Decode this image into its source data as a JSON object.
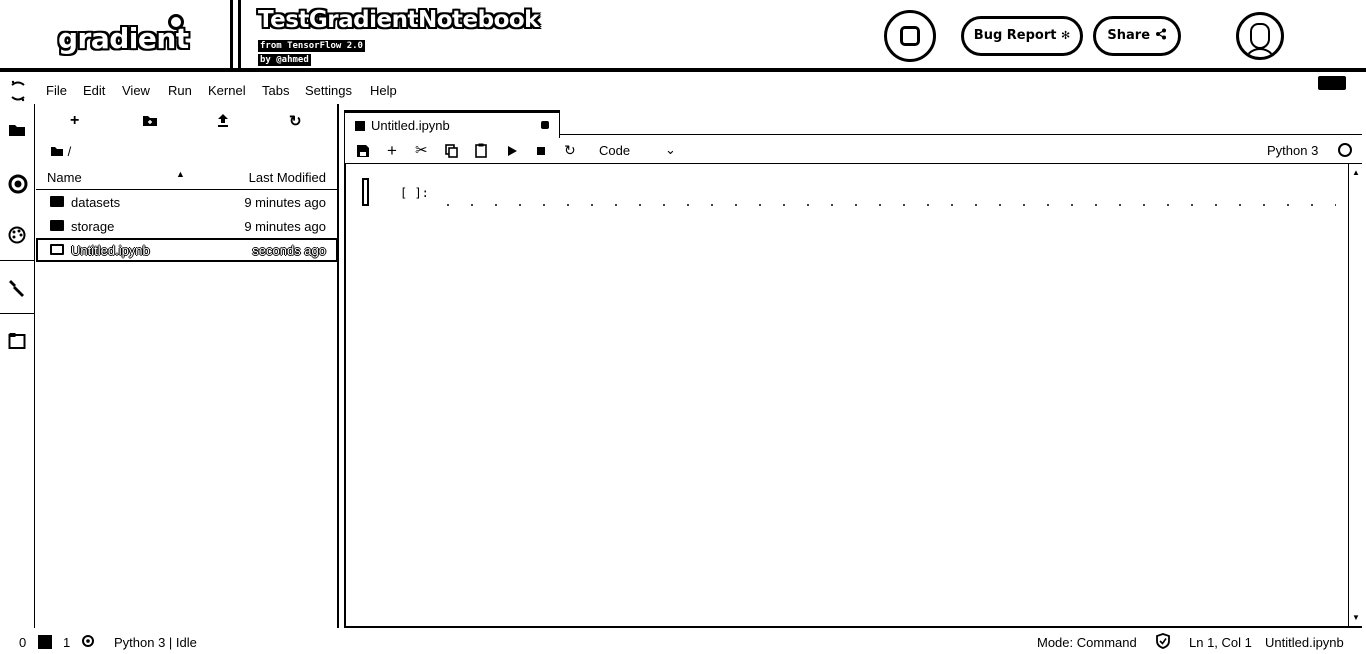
{
  "header": {
    "brand": "gradient",
    "notebook_title": "TestGradientNotebook",
    "subtitle_container": "from TensorFlow 2.0",
    "subtitle_author": "by @ahmed",
    "bug_report_label": "Bug Report",
    "share_label": "Share"
  },
  "menu": {
    "items": [
      "File",
      "Edit",
      "View",
      "Run",
      "Kernel",
      "Tabs",
      "Settings",
      "Help"
    ]
  },
  "file_browser": {
    "breadcrumb": "/",
    "col_name": "Name",
    "col_modified": "Last Modified",
    "files": [
      {
        "name": "datasets",
        "modified": "9 minutes ago",
        "type": "folder-icon"
      },
      {
        "name": "storage",
        "modified": "9 minutes ago",
        "type": "folder-icon"
      },
      {
        "name": "Untitled.ipynb",
        "modified": "seconds ago",
        "type": "notebook-icon"
      }
    ]
  },
  "notebook": {
    "tab_label": "Untitled.ipynb",
    "cell_type": "Code",
    "kernel": "Python 3",
    "cell_prompt": "[ ]:"
  },
  "status": {
    "zero": "0",
    "one": "1",
    "kernel_status": "Python 3 | Idle",
    "mode": "Mode: Command",
    "position": "Ln 1, Col 1",
    "file": "Untitled.ipynb"
  }
}
